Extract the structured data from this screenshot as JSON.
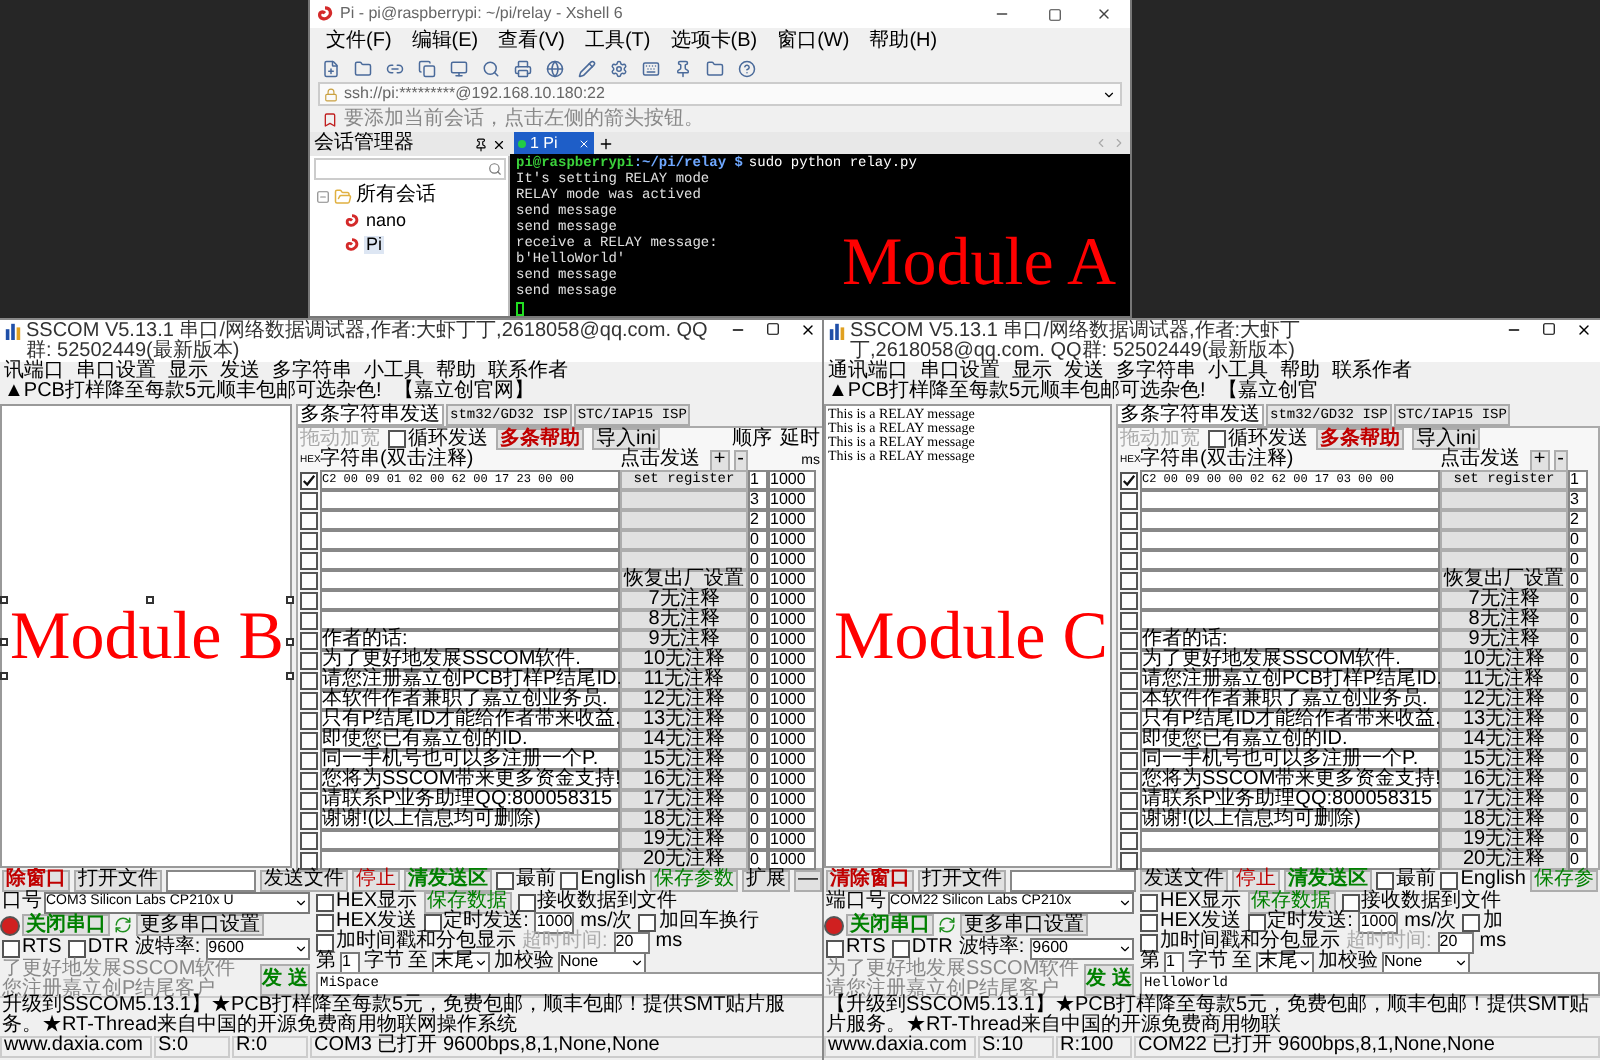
{
  "xshell": {
    "title": "Pi - pi@raspberrypi: ~/pi/relay - Xshell 6",
    "menu": [
      "文件(F)",
      "编辑(E)",
      "查看(V)",
      "工具(T)",
      "选项卡(B)",
      "窗口(W)",
      "帮助(H)"
    ],
    "address": "ssh://pi:*********@192.168.10.180:22",
    "annotation": {
      "text": "Module A"
    },
    "info": "要添加当前会话，点击左侧的箭头按钮。",
    "session_panel": {
      "title": "会话管理器",
      "tree": [
        {
          "label": "所有会话",
          "expanded": true,
          "children": [
            {
              "label": "nano",
              "selected": false
            },
            {
              "label": "Pi",
              "selected": true
            }
          ]
        }
      ]
    },
    "tabs": [
      {
        "label": "1 Pi",
        "selected": true,
        "connected": true
      }
    ],
    "terminal": [
      {
        "kind": "prompt",
        "user": "pi@raspberrypi",
        "path": ":~/pi/relay $",
        "command": "sudo python relay.py"
      },
      {
        "kind": "output",
        "text": "It's setting RELAY mode"
      },
      {
        "kind": "output",
        "text": "RELAY mode was actived"
      },
      {
        "kind": "output",
        "text": "send message"
      },
      {
        "kind": "output",
        "text": "send message"
      },
      {
        "kind": "output",
        "text": "receive a RELAY message:"
      },
      {
        "kind": "output",
        "text": "b'HelloWorld'"
      },
      {
        "kind": "output",
        "text": "send message"
      },
      {
        "kind": "output",
        "text": "send message"
      },
      {
        "kind": "cursor"
      }
    ]
  },
  "sscom": [
    {
      "title": "SSCOM V5.13.1 串口/网络数据调试器,作者:大虾丁丁,2618058@qq.com. QQ群: 52502449(最新版本)",
      "menu": [
        "讯端口",
        "串口设置",
        "显示",
        "发送",
        "多字符串",
        "小工具",
        "帮助",
        "联系作者"
      ],
      "menu_promo": "▲PCB打样降至每款5元顺丰包邮可选杂色!",
      "menu_link": "【嘉立创官网】",
      "annotation": {
        "text": "Module B",
        "selected": true
      },
      "tabs": [
        {
          "label": "多条字符串发送",
          "selected": true
        },
        {
          "label": "stm32/GD32 ISP",
          "selected": false
        },
        {
          "label": "STC/IAP15 ISP",
          "selected": false
        }
      ],
      "panel": {
        "drag": {
          "text": "拖动加宽",
          "disabled": true
        },
        "loop": {
          "label": "循环发送",
          "checked": false
        },
        "help_button": "多条帮助",
        "import_button": "导入ini",
        "order_header": "顺序",
        "delay_header": "延时",
        "hex_header": "HEX",
        "string_header": "字符串(双击注释)",
        "click_header": "点击发送",
        "plus": "+",
        "minus": "-",
        "delay_unit": "ms"
      },
      "rows": [
        {
          "checked": true,
          "text": "C2 00 09 01 02 00 62 00 17 23 00 00",
          "button": "set register",
          "order": "1",
          "delay": "1000"
        },
        {
          "checked": false,
          "text": "",
          "button": "",
          "order": "3",
          "delay": "1000"
        },
        {
          "checked": false,
          "text": "",
          "button": "",
          "order": "2",
          "delay": "1000"
        },
        {
          "checked": false,
          "text": "",
          "button": "",
          "order": "0",
          "delay": "1000"
        },
        {
          "checked": false,
          "text": "",
          "button": "",
          "order": "0",
          "delay": "1000"
        },
        {
          "checked": false,
          "text": "",
          "button": "恢复出厂设置",
          "order": "0",
          "delay": "1000"
        },
        {
          "checked": false,
          "text": "",
          "button": "7无注释",
          "order": "0",
          "delay": "1000"
        },
        {
          "checked": false,
          "text": "",
          "button": "8无注释",
          "order": "0",
          "delay": "1000"
        },
        {
          "checked": false,
          "text": "作者的话:",
          "button": "9无注释",
          "order": "0",
          "delay": "1000"
        },
        {
          "checked": false,
          "text": "为了更好地发展SSCOM软件.",
          "button": "10无注释",
          "order": "0",
          "delay": "1000"
        },
        {
          "checked": false,
          "text": "请您注册嘉立创PCB打样P结尾ID.",
          "button": "11无注释",
          "order": "0",
          "delay": "1000"
        },
        {
          "checked": false,
          "text": "本软件作者兼职了嘉立创业务员.",
          "button": "12无注释",
          "order": "0",
          "delay": "1000"
        },
        {
          "checked": false,
          "text": "只有P结尾ID才能给作者带来收益.",
          "button": "13无注释",
          "order": "0",
          "delay": "1000"
        },
        {
          "checked": false,
          "text": "即使您已有嘉立创的ID.",
          "button": "14无注释",
          "order": "0",
          "delay": "1000"
        },
        {
          "checked": false,
          "text": "同一手机号也可以多注册一个P.",
          "button": "15无注释",
          "order": "0",
          "delay": "1000"
        },
        {
          "checked": false,
          "text": "您将为SSCOM带来更多资金支持!",
          "button": "16无注释",
          "order": "0",
          "delay": "1000"
        },
        {
          "checked": false,
          "text": "请联系P业务助理QQ:800058315",
          "button": "17无注释",
          "order": "0",
          "delay": "1000"
        },
        {
          "checked": false,
          "text": "谢谢!(以上信息均可删除)",
          "button": "18无注释",
          "order": "0",
          "delay": "1000"
        },
        {
          "checked": false,
          "text": "",
          "button": "19无注释",
          "order": "0",
          "delay": "1000"
        },
        {
          "checked": false,
          "text": "",
          "button": "20无注释",
          "order": "0",
          "delay": "1000"
        }
      ],
      "bottom": {
        "clear_button": "除窗口",
        "open_file_button": "打开文件",
        "send_file_button": "发送文件",
        "stop_button": "停止",
        "clear_send_button": "清发送区",
        "topmost": {
          "label": "最前",
          "checked": false
        },
        "english": {
          "label": "English",
          "checked": false
        },
        "save_params_button": "保存参数",
        "expand_button": "扩展",
        "collapse_button": "—",
        "port_label": "口号",
        "port": "COM3 Silicon Labs CP210x U",
        "hex_display": {
          "label": "HEX显示",
          "checked": false
        },
        "save_data_button": "保存数据",
        "recv_to_file": {
          "label": "接收数据到文件",
          "checked": false
        },
        "hex_send": {
          "label": "HEX发送",
          "checked": false
        },
        "timed_send": {
          "label": "定时发送:",
          "checked": false
        },
        "interval": "1000",
        "interval_unit": "ms/次",
        "append_newline": {
          "label": "加回车换行",
          "checked": false
        },
        "close_port_button": "关闭串口",
        "more_settings_button": "更多串口设置",
        "timestamp": {
          "label": "加时间戳和分包显示",
          "checked": false
        },
        "timeout_label": {
          "text": "超时时间:",
          "disabled": true
        },
        "timeout": "20",
        "timeout_unit": "ms",
        "from_label": "第",
        "from": "1",
        "byte_label": "字节",
        "to_label": "至",
        "to": "末尾",
        "checksum_label": "加校验",
        "checksum": "None",
        "rts": {
          "label": "RTS",
          "checked": false
        },
        "dtr": {
          "label": "DTR",
          "checked": false
        },
        "baud_label": "波特率:",
        "baud": "9600",
        "send_text": "MiSpace",
        "promo": [
          "了更好地发展SSCOM软件",
          "您注册嘉立创P结尾客户"
        ],
        "send_button": "发 送"
      },
      "ticker": "升级到SSCOM5.13.1】★PCB打样降至每款5元，免费包邮，顺丰包邮！提供SMT贴片服务。★RT-Thread来自中国的开源免费商用物联网操作系统",
      "status": [
        "www.daxia.com",
        "S:0",
        "R:0",
        "COM3 已打开  9600bps,8,1,None,None"
      ]
    },
    {
      "title": "SSCOM V5.13.1 串口/网络数据调试器,作者:大虾丁丁,2618058@qq.com. QQ群: 52502449(最新版本)",
      "menu": [
        "通讯端口",
        "串口设置",
        "显示",
        "发送",
        "多字符串",
        "小工具",
        "帮助",
        "联系作者"
      ],
      "menu_promo": "▲PCB打样降至每款5元顺丰包邮可选杂色!",
      "menu_link": "【嘉立创官",
      "annotation": {
        "text": "Module C"
      },
      "receive_lines": [
        "This is a RELAY message",
        "This is a RELAY message",
        "This is a RELAY message",
        "This is a RELAY message"
      ],
      "tabs": [
        {
          "label": "多条字符串发送",
          "selected": true
        },
        {
          "label": "stm32/GD32 ISP",
          "selected": false
        },
        {
          "label": "STC/IAP15 ISP",
          "selected": false
        }
      ],
      "panel": {
        "drag": {
          "text": "拖动加宽",
          "disabled": true
        },
        "loop": {
          "label": "循环发送",
          "checked": false
        },
        "help_button": "多条帮助",
        "import_button": "导入ini",
        "hex_header": "HEX",
        "string_header": "字符串(双击注释)",
        "click_header": "点击发送",
        "plus": "+",
        "minus": "-"
      },
      "rows": [
        {
          "checked": true,
          "text": "C2 00 09 00 00 02 62 00 17 03 00 00",
          "button": "set register",
          "order": "1"
        },
        {
          "checked": false,
          "text": "",
          "button": "",
          "order": "3"
        },
        {
          "checked": false,
          "text": "",
          "button": "",
          "order": "2"
        },
        {
          "checked": false,
          "text": "",
          "button": "",
          "order": "0"
        },
        {
          "checked": false,
          "text": "",
          "button": "",
          "order": "0"
        },
        {
          "checked": false,
          "text": "",
          "button": "恢复出厂设置",
          "order": "0"
        },
        {
          "checked": false,
          "text": "",
          "button": "7无注释",
          "order": "0"
        },
        {
          "checked": false,
          "text": "",
          "button": "8无注释",
          "order": "0"
        },
        {
          "checked": false,
          "text": "作者的话:",
          "button": "9无注释",
          "order": "0"
        },
        {
          "checked": false,
          "text": "为了更好地发展SSCOM软件.",
          "button": "10无注释",
          "order": "0"
        },
        {
          "checked": false,
          "text": "请您注册嘉立创PCB打样P结尾ID.",
          "button": "11无注释",
          "order": "0"
        },
        {
          "checked": false,
          "text": "本软件作者兼职了嘉立创业务员.",
          "button": "12无注释",
          "order": "0"
        },
        {
          "checked": false,
          "text": "只有P结尾ID才能给作者带来收益.",
          "button": "13无注释",
          "order": "0"
        },
        {
          "checked": false,
          "text": "即使您已有嘉立创的ID.",
          "button": "14无注释",
          "order": "0"
        },
        {
          "checked": false,
          "text": "同一手机号也可以多注册一个P.",
          "button": "15无注释",
          "order": "0"
        },
        {
          "checked": false,
          "text": "您将为SSCOM带来更多资金支持!",
          "button": "16无注释",
          "order": "0"
        },
        {
          "checked": false,
          "text": "请联系P业务助理QQ:800058315",
          "button": "17无注释",
          "order": "0"
        },
        {
          "checked": false,
          "text": "谢谢!(以上信息均可删除)",
          "button": "18无注释",
          "order": "0"
        },
        {
          "checked": false,
          "text": "",
          "button": "19无注释",
          "order": "0"
        },
        {
          "checked": false,
          "text": "",
          "button": "20无注释",
          "order": "0"
        }
      ],
      "bottom": {
        "clear_button": "清除窗口",
        "open_file_button": "打开文件",
        "send_file_button": "发送文件",
        "stop_button": "停止",
        "clear_send_button": "清发送区",
        "topmost": {
          "label": "最前",
          "checked": false
        },
        "english": {
          "label": "English",
          "checked": false
        },
        "save_params_button": "保存参",
        "port_label": "端口号",
        "port": "COM22 Silicon Labs CP210x",
        "hex_display": {
          "label": "HEX显示",
          "checked": false
        },
        "save_data_button": "保存数据",
        "recv_to_file": {
          "label": "接收数据到文件",
          "checked": false
        },
        "hex_send": {
          "label": "HEX发送",
          "checked": false
        },
        "timed_send": {
          "label": "定时发送:",
          "checked": false
        },
        "interval": "1000",
        "interval_unit": "ms/次",
        "append_newline": {
          "label": "加",
          "checked": false
        },
        "close_port_button": "关闭串口",
        "more_settings_button": "更多串口设置",
        "timestamp": {
          "label": "加时间戳和分包显示",
          "checked": false
        },
        "timeout_label": {
          "text": "超时时间:",
          "disabled": true
        },
        "timeout": "20",
        "timeout_unit": "ms",
        "from_label": "第",
        "from": "1",
        "byte_label": "字节",
        "to_label": "至",
        "to": "末尾",
        "checksum_label": "加校验",
        "checksum": "None",
        "rts": {
          "label": "RTS",
          "checked": false
        },
        "dtr": {
          "label": "DTR",
          "checked": false
        },
        "baud_label": "波特率:",
        "baud": "9600",
        "send_text": "HelloWorld",
        "promo": [
          "为了更好地发展SSCOM软件",
          "请您注册嘉立创P结尾客户"
        ],
        "send_button": "发 送"
      },
      "ticker": "【升级到SSCOM5.13.1】★PCB打样降至每款5元，免费包邮，顺丰包邮！提供SMT贴片服务。★RT-Thread来自中国的开源免费商用物联",
      "status": [
        "www.daxia.com",
        "S:10",
        "R:100",
        "COM22 已打开  9600bps,8,1,None,None"
      ]
    }
  ]
}
